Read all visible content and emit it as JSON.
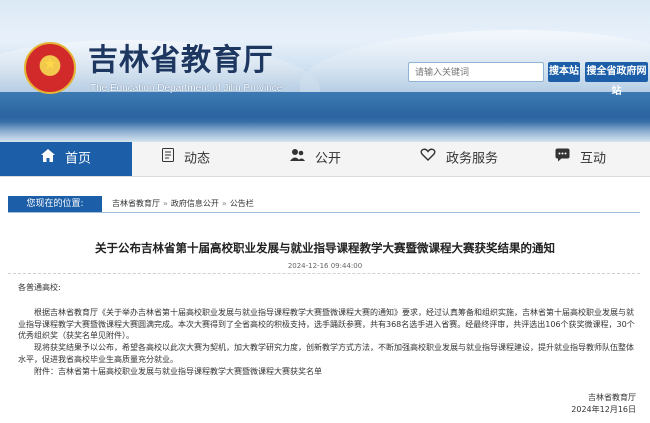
{
  "header": {
    "title": "吉林省教育厅",
    "subtitle": "The Education Department of Jilin Province",
    "search_placeholder": "请输入关键词",
    "search_site_label": "搜本站",
    "search_province_label": "搜全省政府网站"
  },
  "nav": {
    "items": [
      {
        "label": "首页",
        "icon": "home-icon"
      },
      {
        "label": "动态",
        "icon": "document-icon"
      },
      {
        "label": "公开",
        "icon": "people-icon"
      },
      {
        "label": "政务服务",
        "icon": "heart-hand-icon"
      },
      {
        "label": "互动",
        "icon": "chat-icon"
      }
    ],
    "active_color": "#1c5fa8"
  },
  "breadcrumb": {
    "label": "您现在的位置:",
    "items": [
      "吉林省教育厅",
      "政府信息公开",
      "公告栏"
    ]
  },
  "article": {
    "title": "关于公布吉林省第十届高校职业发展与就业指导课程教学大赛暨微课程大赛获奖结果的通知",
    "date": "2024-12-16 09:44:00",
    "salutation": "各普通高校:",
    "para1": "根据吉林省教育厅《关于举办吉林省第十届高校职业发展与就业指导课程教学大赛暨微课程大赛的通知》要求，经过认真筹备和组织实施，吉林省第十届高校职业发展与就业指导课程教学大赛暨微课程大赛圆满完成。本次大赛得到了全省高校的积极支持，选手踊跃参赛，共有368名选手进入省赛。经最终评审，共评选出106个获奖微课程，30个优秀组织奖（获奖名单见附件）。",
    "para2": "现将获奖结果予以公布，希望各高校以此次大赛为契机，加大教学研究力度，创新教学方式方法，不断加强高校职业发展与就业指导课程建设，提升就业指导教师队伍整体水平，促进我省高校毕业生高质量充分就业。",
    "attachment": "附件：吉林省第十届高校职业发展与就业指导课程教学大赛暨微课程大赛获奖名单",
    "signature_org": "吉林省教育厅",
    "signature_date": "2024年12月16日"
  }
}
